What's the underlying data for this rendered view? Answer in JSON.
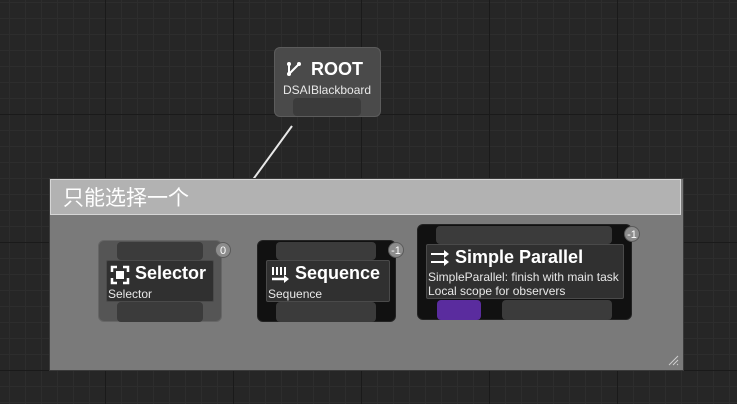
{
  "comment": {
    "title": "只能选择一个"
  },
  "root": {
    "title": "ROOT",
    "subtitle": "DSAIBlackboard",
    "icon": "root-branch-icon"
  },
  "selector": {
    "title": "Selector",
    "subtitle": "Selector",
    "badge": "0",
    "icon": "selector-icon"
  },
  "sequence": {
    "title": "Sequence",
    "subtitle": "Sequence",
    "badge": "-1",
    "icon": "sequence-icon"
  },
  "parallel": {
    "title": "Simple Parallel",
    "line1": "SimpleParallel: finish with main task",
    "line2": "Local scope for observers",
    "badge": "-1",
    "icon": "parallel-arrows-icon",
    "main_pin_color": "#5a2c9e"
  }
}
